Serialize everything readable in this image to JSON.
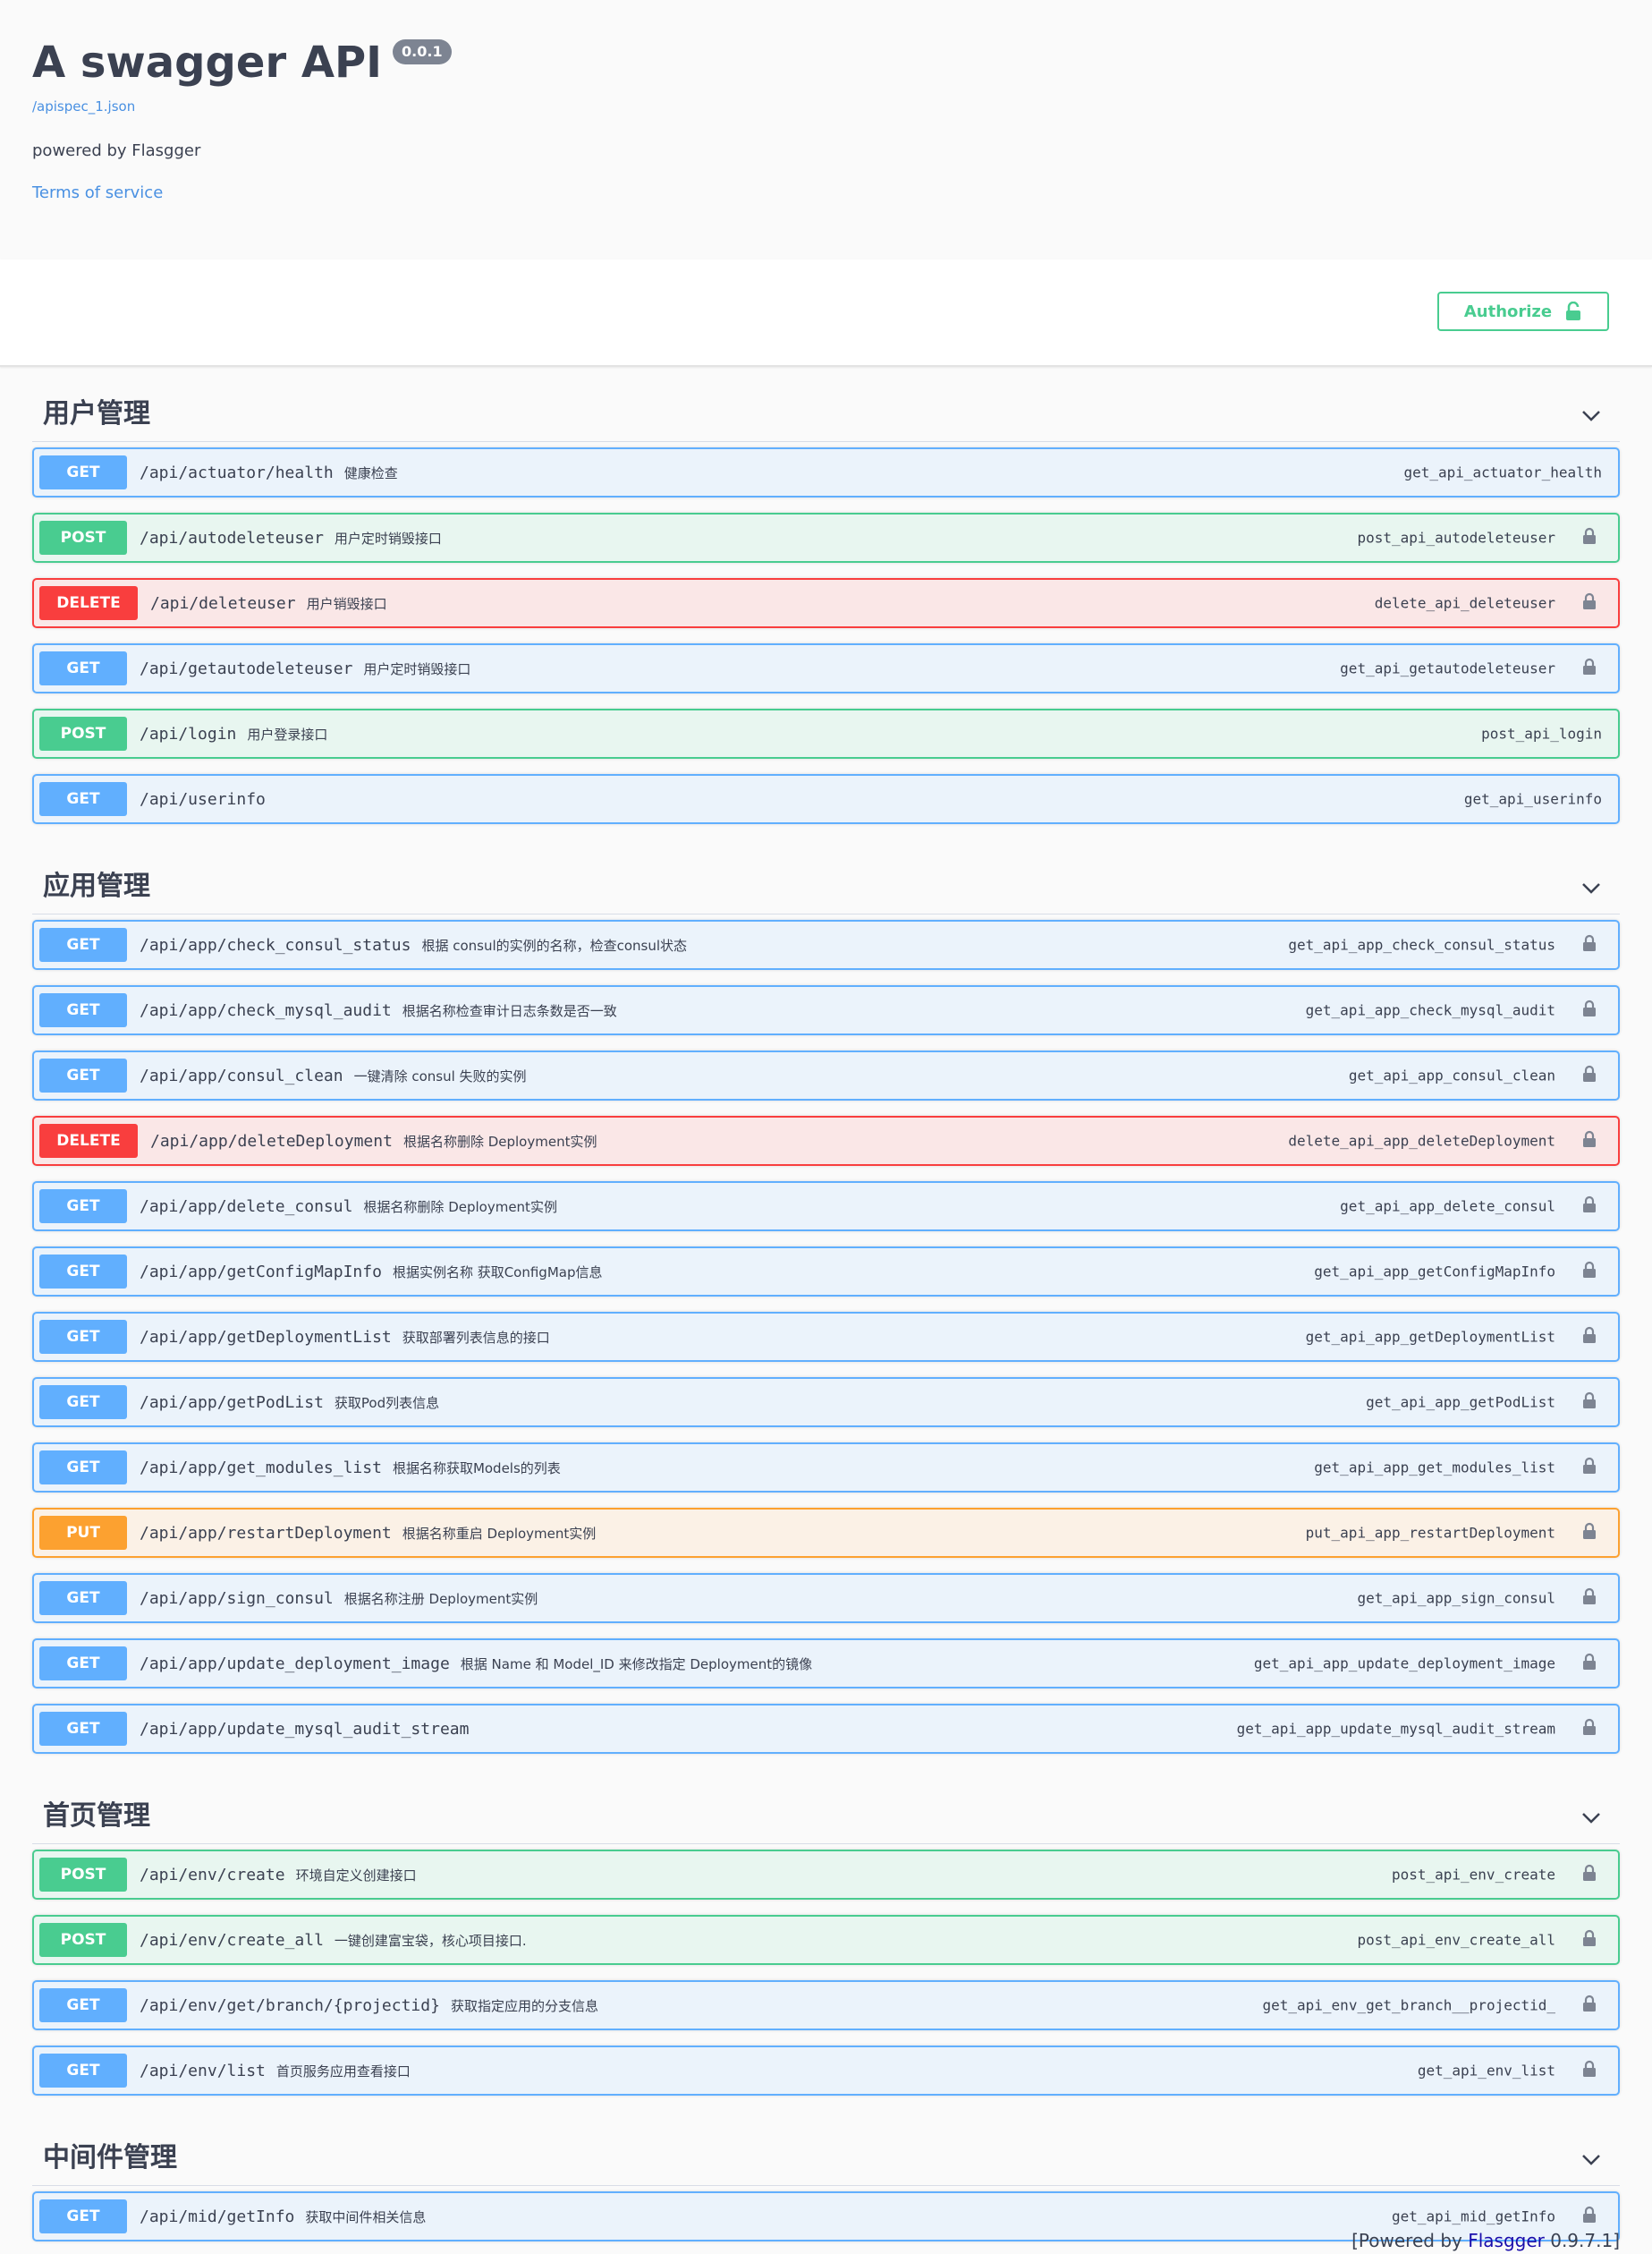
{
  "info": {
    "title": "A swagger API",
    "version": "0.0.1",
    "spec_url": "/apispec_1.json",
    "description": "powered by Flasgger",
    "terms_label": "Terms of service"
  },
  "authorize": {
    "label": "Authorize",
    "icon": "unlock-icon"
  },
  "colors": {
    "get": "#61affe",
    "post": "#49cc90",
    "delete": "#f93e3e",
    "put": "#fca130"
  },
  "tags": [
    {
      "name": "用户管理",
      "operations": [
        {
          "method": "GET",
          "path": "/api/actuator/health",
          "summary": "健康检查",
          "op_id": "get_api_actuator_health",
          "locked": false
        },
        {
          "method": "POST",
          "path": "/api/autodeleteuser",
          "summary": "用户定时销毁接口",
          "op_id": "post_api_autodeleteuser",
          "locked": true
        },
        {
          "method": "DELETE",
          "path": "/api/deleteuser",
          "summary": "用户销毁接口",
          "op_id": "delete_api_deleteuser",
          "locked": true
        },
        {
          "method": "GET",
          "path": "/api/getautodeleteuser",
          "summary": "用户定时销毁接口",
          "op_id": "get_api_getautodeleteuser",
          "locked": true
        },
        {
          "method": "POST",
          "path": "/api/login",
          "summary": "用户登录接口",
          "op_id": "post_api_login",
          "locked": false
        },
        {
          "method": "GET",
          "path": "/api/userinfo",
          "summary": "",
          "op_id": "get_api_userinfo",
          "locked": false
        }
      ]
    },
    {
      "name": "应用管理",
      "operations": [
        {
          "method": "GET",
          "path": "/api/app/check_consul_status",
          "summary": "根据 consul的实例的名称，检查consul状态",
          "op_id": "get_api_app_check_consul_status",
          "locked": true
        },
        {
          "method": "GET",
          "path": "/api/app/check_mysql_audit",
          "summary": "根据名称检查审计日志条数是否一致",
          "op_id": "get_api_app_check_mysql_audit",
          "locked": true
        },
        {
          "method": "GET",
          "path": "/api/app/consul_clean",
          "summary": "一键清除 consul 失败的实例",
          "op_id": "get_api_app_consul_clean",
          "locked": true
        },
        {
          "method": "DELETE",
          "path": "/api/app/deleteDeployment",
          "summary": "根据名称删除 Deployment实例",
          "op_id": "delete_api_app_deleteDeployment",
          "locked": true
        },
        {
          "method": "GET",
          "path": "/api/app/delete_consul",
          "summary": "根据名称删除 Deployment实例",
          "op_id": "get_api_app_delete_consul",
          "locked": true
        },
        {
          "method": "GET",
          "path": "/api/app/getConfigMapInfo",
          "summary": "根据实例名称 获取ConfigMap信息",
          "op_id": "get_api_app_getConfigMapInfo",
          "locked": true
        },
        {
          "method": "GET",
          "path": "/api/app/getDeploymentList",
          "summary": "获取部署列表信息的接口",
          "op_id": "get_api_app_getDeploymentList",
          "locked": true
        },
        {
          "method": "GET",
          "path": "/api/app/getPodList",
          "summary": "获取Pod列表信息",
          "op_id": "get_api_app_getPodList",
          "locked": true
        },
        {
          "method": "GET",
          "path": "/api/app/get_modules_list",
          "summary": "根据名称获取Models的列表",
          "op_id": "get_api_app_get_modules_list",
          "locked": true
        },
        {
          "method": "PUT",
          "path": "/api/app/restartDeployment",
          "summary": "根据名称重启 Deployment实例",
          "op_id": "put_api_app_restartDeployment",
          "locked": true
        },
        {
          "method": "GET",
          "path": "/api/app/sign_consul",
          "summary": "根据名称注册 Deployment实例",
          "op_id": "get_api_app_sign_consul",
          "locked": true
        },
        {
          "method": "GET",
          "path": "/api/app/update_deployment_image",
          "summary": "根据 Name 和 Model_ID 来修改指定 Deployment的镜像",
          "op_id": "get_api_app_update_deployment_image",
          "locked": true
        },
        {
          "method": "GET",
          "path": "/api/app/update_mysql_audit_stream",
          "summary": "",
          "op_id": "get_api_app_update_mysql_audit_stream",
          "locked": true
        }
      ]
    },
    {
      "name": "首页管理",
      "operations": [
        {
          "method": "POST",
          "path": "/api/env/create",
          "summary": "环境自定义创建接口",
          "op_id": "post_api_env_create",
          "locked": true
        },
        {
          "method": "POST",
          "path": "/api/env/create_all",
          "summary": "一键创建富宝袋，核心项目接口.",
          "op_id": "post_api_env_create_all",
          "locked": true
        },
        {
          "method": "GET",
          "path": "/api/env/get/branch/{projectid}",
          "summary": "获取指定应用的分支信息",
          "op_id": "get_api_env_get_branch__projectid_",
          "locked": true
        },
        {
          "method": "GET",
          "path": "/api/env/list",
          "summary": "首页服务应用查看接口",
          "op_id": "get_api_env_list",
          "locked": true
        }
      ]
    },
    {
      "name": "中间件管理",
      "operations": [
        {
          "method": "GET",
          "path": "/api/mid/getInfo",
          "summary": "获取中间件相关信息",
          "op_id": "get_api_mid_getInfo",
          "locked": true
        }
      ]
    }
  ],
  "footer": {
    "prefix": "[Powered by ",
    "link_label": "Flasgger",
    "suffix": " 0.9.7.1]"
  }
}
